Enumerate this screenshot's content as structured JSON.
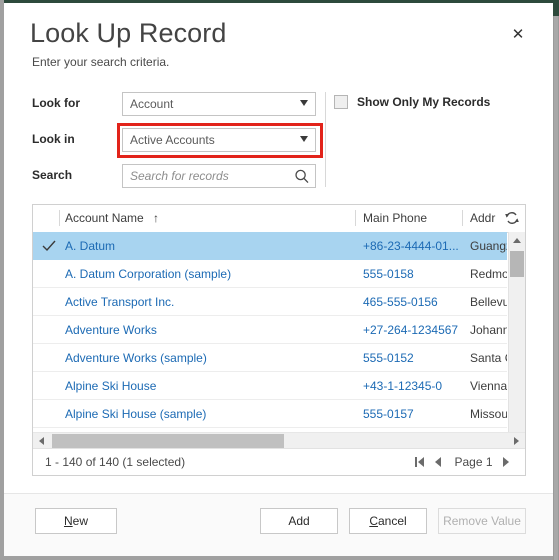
{
  "window": {
    "frame_color": "#2d4a3c",
    "background": "#ffffff"
  },
  "header": {
    "title": "Look Up Record",
    "subtitle": "Enter your search criteria.",
    "close_icon": "close-icon",
    "close_glyph": "✕"
  },
  "criteria": {
    "look_for": {
      "label": "Look for",
      "value": "Account",
      "dropdown_icon": "chevron-down-icon"
    },
    "look_in": {
      "label": "Look in",
      "value": "Active Accounts",
      "dropdown_icon": "chevron-down-icon",
      "highlight_color": "#e2231a",
      "highlighted": true
    },
    "search": {
      "label": "Search",
      "value": "",
      "placeholder": "Search for records",
      "icon": "search-icon"
    },
    "show_only_my_records": {
      "label": "Show Only My Records",
      "checked": false
    }
  },
  "grid": {
    "columns": [
      {
        "key": "check",
        "label": ""
      },
      {
        "key": "name",
        "label": "Account Name",
        "sort": "ascending",
        "sort_glyph": "↑"
      },
      {
        "key": "phone",
        "label": "Main Phone"
      },
      {
        "key": "address",
        "label": "Addr"
      }
    ],
    "refresh_icon": "refresh-icon",
    "rows": [
      {
        "name": "A. Datum",
        "phone": "+86-23-4444-01...",
        "address": "Guangz",
        "selected": true,
        "check_glyph": "✓"
      },
      {
        "name": "A. Datum Corporation (sample)",
        "phone": "555-0158",
        "address": "Redmor",
        "selected": false
      },
      {
        "name": "Active Transport Inc.",
        "phone": "465-555-0156",
        "address": "Bellevue",
        "selected": false
      },
      {
        "name": "Adventure Works",
        "phone": "+27-264-1234567",
        "address": "Johanne",
        "selected": false
      },
      {
        "name": "Adventure Works (sample)",
        "phone": "555-0152",
        "address": "Santa C",
        "selected": false
      },
      {
        "name": "Alpine Ski House",
        "phone": "+43-1-12345-0",
        "address": "Vienna",
        "selected": false
      },
      {
        "name": "Alpine Ski House (sample)",
        "phone": "555-0157",
        "address": "Missoul",
        "selected": false
      }
    ],
    "footer": {
      "record_count": "1 - 140 of 140 (1 selected)",
      "pager": {
        "first_label": "first-page",
        "previous_label": "previous-page",
        "page_label": "Page 1",
        "next_label": "next-page"
      }
    },
    "scrollbars": {
      "vertical_icon_up": "scroll-up-icon",
      "vertical_icon_down": "scroll-down-icon",
      "horizontal_icon_left": "scroll-left-icon",
      "horizontal_icon_right": "scroll-right-icon"
    }
  },
  "buttons": {
    "new": {
      "label": "New",
      "accel": "N",
      "rest": "ew",
      "disabled": false
    },
    "add": {
      "label": "Add",
      "accel": "",
      "rest": "Add",
      "disabled": false
    },
    "cancel": {
      "label": "Cancel",
      "accel": "C",
      "rest": "ancel",
      "disabled": false
    },
    "remove": {
      "label": "Remove Value",
      "accel": "",
      "rest": "Remove Value",
      "disabled": true
    }
  }
}
